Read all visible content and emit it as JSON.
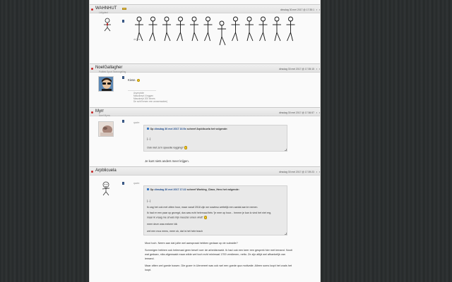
{
  "colors": {
    "link": "#1e4b8c",
    "quote_bg": "#e9e9e9",
    "header_bg": "#e6e6e6",
    "rank_badge": "#e6c24a"
  },
  "posts": [
    {
      "username": "WAHNHUT",
      "usertitle": "Lidigdast",
      "date": "dinsdag 30 mei 2017 @ 17:35:1",
      "ctrl_prev": "▪",
      "ctrl_next": "▪",
      "avatar_icon": "stickman-icon",
      "signature": "de hoe"
    },
    {
      "username": "NoelGallagher",
      "usertitle": "Politiek Sport Stoeongeling",
      "date": "dinsdag 30 mei 2017 @ 17:35:15",
      "ctrl_prev": "▪",
      "ctrl_next": "▪",
      "avatar_icon": "sunglasses-avatar-icon",
      "message": "Kiese.",
      "sig_lines": [
        "Asymptote",
        "Masokrept 4 leggen",
        "Masokrept 200 leners",
        "De schif hesen een anosensaken)"
      ]
    },
    {
      "username": "Myrr",
      "usertitle": "Noel Myrra",
      "date": "dinsdag 30 mei 2017 @ 17:36:57",
      "ctrl_prev": "▪",
      "ctrl_next": "▪",
      "avatar_icon": "photo-avatar-icon",
      "quote_label": "quote:",
      "quote": {
        "prefix": "Op",
        "link": "dinsdag 30 mei 2017 16:5x",
        "author": "schreef Arpblicuela het volgende:",
        "lines": [
          "[...]",
          "Ook niet zo'n speedie logging?"
        ]
      },
      "message": "Je kunt niets anders meer krijgen."
    },
    {
      "username": "Arpblicuela",
      "usertitle": "",
      "date": "dinsdag 30 mei 2017 @ 17:39:23",
      "ctrl_prev": "▪",
      "ctrl_next": "▪",
      "avatar_icon": "stickman-avatar-icon",
      "quote_label": "quote:",
      "quote": {
        "prefix": "Op",
        "link": "dinsdag 30 mei 2017 17:22",
        "author": "schreef Working_Class_Hero het volgende:",
        "lines": [
          "[...]",
          "Ik zag het ook met zitten hoor, maar vanaf 2018 zijn we sowieso wettelijk een aantal aan te nemen.",
          "Ik had er een paar op gezegd, dus was echt helemaal fiets \"je mee op hoor... hmmm je kan lo vind het niet erg,",
          "maar ik vraag me af wat mijn meester omen vindt\"",
          "meer deze was mekeer Idk",
          "wel een mus mens, meer ok, dat is het hele teach"
        ]
      },
      "message_lines": [
        "Mooi toch. Neem aan dat jullie wel aanspraak hebben gedaan op de subsidie?",
        "Sommigen hebben ook helemaal geen besef over de arbeidsmarkt. Ik had ook een keer een gesprek hier met iemand. Nooit",
        "wat gedaan, niks afgemaakt maar wilde wel toch echt minimaal 1700 verdienen, netto. Ze zijn altijd wel afhankelijk van",
        "iemand.",
        "Maar zitten wel goede tussen. Die gozer in Uienereet was ook wel een goede qua motivatie. Alleen soms loopt het zoals het",
        "loopt."
      ]
    }
  ]
}
